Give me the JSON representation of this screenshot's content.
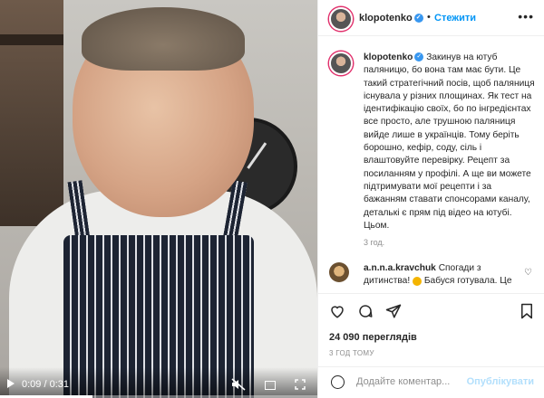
{
  "video": {
    "time_display": "0:09 / 0:31",
    "progress_fraction": 0.29
  },
  "header": {
    "username": "klopotenko",
    "dot": "•",
    "follow_label": "Стежити",
    "more_label": "•••"
  },
  "caption": {
    "username": "klopotenko",
    "text": "Закинув на ютуб паляницю, бо вона там має бути. Це такий стратегічний посів, щоб паляниця існувала у різних площинах. Як тест на ідентифікацію своїх, бо по інгредієнтах все просто, але трушною паляниця вийде лише в українців. Тому беріть борошно, кефір, соду, сіль і влаштовуйте перевірку. Рецепт за посиланням у профілі. А ще ви можете підтримувати мої рецепти і за бажанням ставати спонсорами каналу, деталькі є прям під відео на ютубі. Цьом.",
    "time": "3 год."
  },
  "comment": {
    "username": "a.n.n.a.kravchuk",
    "text_before_emoji": "Спогади з дитинства!",
    "text_after_emoji": "Бабуся готувала. Це"
  },
  "stats": {
    "views": "24 090 переглядів",
    "ago": "3 ГОД ТОМУ"
  },
  "add_comment": {
    "placeholder": "Додайте коментар...",
    "post_label": "Опублікувати"
  }
}
